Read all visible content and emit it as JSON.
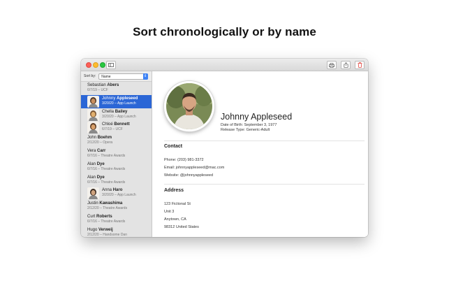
{
  "headline": "Sort chronologically or by name",
  "sidebar": {
    "sort_label": "Sort by:",
    "sort_value": "Name",
    "items": [
      {
        "first": "Sebastian",
        "last": "Abers",
        "date": "6/7/19",
        "event": "UCF",
        "photo": false,
        "selected": false
      },
      {
        "first": "Johnny",
        "last": "Appleseed",
        "date": "3/20/20",
        "event": "App Launch",
        "photo": true,
        "selected": true
      },
      {
        "first": "Chella",
        "last": "Bailey",
        "date": "3/20/20",
        "event": "App Launch",
        "photo": true,
        "selected": false
      },
      {
        "first": "Chloé",
        "last": "Bennett",
        "date": "6/7/19",
        "event": "UCF",
        "photo": true,
        "selected": false
      },
      {
        "first": "John",
        "last": "Boehm",
        "date": "2/12/20",
        "event": "Opera",
        "photo": false,
        "selected": false
      },
      {
        "first": "Vera",
        "last": "Carr",
        "date": "6/7/16",
        "event": "Theatre Awards",
        "photo": false,
        "selected": false
      },
      {
        "first": "Alan",
        "last": "Dye",
        "date": "6/7/16",
        "event": "Theatre Awards",
        "photo": false,
        "selected": false
      },
      {
        "first": "Alan",
        "last": "Dye",
        "date": "6/7/16",
        "event": "Theatre Awards",
        "photo": false,
        "selected": false
      },
      {
        "first": "Anna",
        "last": "Haro",
        "date": "3/20/20",
        "event": "App Launch",
        "photo": true,
        "selected": false
      },
      {
        "first": "Justin",
        "last": "Kawashima",
        "date": "2/12/20",
        "event": "Theatre Awards",
        "photo": false,
        "selected": false
      },
      {
        "first": "Curt",
        "last": "Roberts",
        "date": "6/7/16",
        "event": "Theatre Awards",
        "photo": false,
        "selected": false
      },
      {
        "first": "Hugo",
        "last": "Verweij",
        "date": "2/12/20",
        "event": "Handsome Dan",
        "photo": false,
        "selected": false
      }
    ]
  },
  "detail": {
    "name": "Johnny Appleseed",
    "dob": "Date of Birth: September 3, 1977",
    "release": "Release Type: Generic-Adult",
    "contact_title": "Contact",
    "phone": "Phone:  (203) 981-3372",
    "email": "Email:  johnnyappleseed@mac.com",
    "website": "Website:  @johnnyappleseed",
    "address_title": "Address",
    "address_lines": [
      "123 Fictional St",
      "Unit 3",
      "Anytown,  CA",
      "98312  United States"
    ]
  },
  "icons": {
    "sidebar_toggle": "sidebar-toggle-icon",
    "print": "print-icon",
    "share": "share-icon",
    "trash": "trash-icon"
  },
  "colors": {
    "selection": "#2b66d6",
    "trash": "#e0443e",
    "close": "#fc5f57",
    "minimize": "#fdbc2e",
    "zoom": "#28c840"
  }
}
